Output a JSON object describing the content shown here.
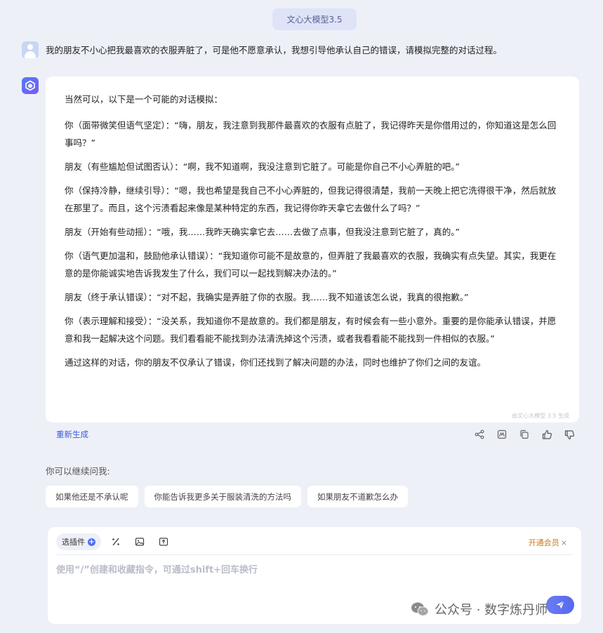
{
  "model_chip": "文心大模型3.5",
  "question": "我的朋友不小心把我最喜欢的衣服弄脏了，可是他不愿意承认，我想引导他承认自己的错误，请模拟完整的对话过程。",
  "answer": {
    "paragraphs": [
      "当然可以，以下是一个可能的对话模拟：",
      "你（面带微笑但语气坚定）：“嗨，朋友，我注意到我那件最喜欢的衣服有点脏了，我记得昨天是你借用过的，你知道这是怎么回事吗？”",
      "朋友（有些尴尬但试图否认）：“啊，我不知道啊，我没注意到它脏了。可能是你自己不小心弄脏的吧。”",
      "你（保持冷静，继续引导）：“嗯，我也希望是我自己不小心弄脏的，但我记得很清楚，我前一天晚上把它洗得很干净，然后就放在那里了。而且，这个污渍看起来像是某种特定的东西，我记得你昨天拿它去做什么了吗？”",
      "朋友（开始有些动摇）：“哦，我……我昨天确实拿它去……去做了点事，但我没注意到它脏了，真的。”",
      "你（语气更加温和，鼓励他承认错误）：“我知道你可能不是故意的，但弄脏了我最喜欢的衣服，我确实有点失望。其实，我更在意的是你能诚实地告诉我发生了什么，我们可以一起找到解决办法的。”",
      "朋友（终于承认错误）：“对不起，我确实是弄脏了你的衣服。我……我不知道该怎么说，我真的很抱歉。”",
      "你（表示理解和接受）：“没关系，我知道你不是故意的。我们都是朋友，有时候会有一些小意外。重要的是你能承认错误，并愿意和我一起解决这个问题。我们看看能不能找到办法清洗掉这个污渍，或者我看看能不能找到一件相似的衣服。”",
      "通过这样的对话，你的朋友不仅承认了错误，你们还找到了解决问题的办法，同时也维护了你们之间的友谊。"
    ],
    "generated_by": "由文心大模型 3.5 生成"
  },
  "regenerate_label": "重新生成",
  "actions": [
    {
      "icon": "share-icon"
    },
    {
      "icon": "image-icon"
    },
    {
      "icon": "copy-icon"
    },
    {
      "icon": "thumbs-up-icon"
    },
    {
      "icon": "thumbs-down-icon"
    }
  ],
  "continue_label": "你可以继续问我:",
  "suggestions": [
    "如果他还是不承认呢",
    "你能告诉我更多关于服装清洗的方法吗",
    "如果朋友不道歉怎么办"
  ],
  "input": {
    "plugin_label": "选插件",
    "vip_label": "开通会员",
    "vip_close": "×",
    "placeholder": "使用“/”创建和收藏指令，可通过shift+回车换行"
  },
  "watermark": "公众号 · 数字炼丹师",
  "colors": {
    "background": "#eef0f8",
    "accent": "#3b5bdb",
    "vip": "#c9781f"
  }
}
